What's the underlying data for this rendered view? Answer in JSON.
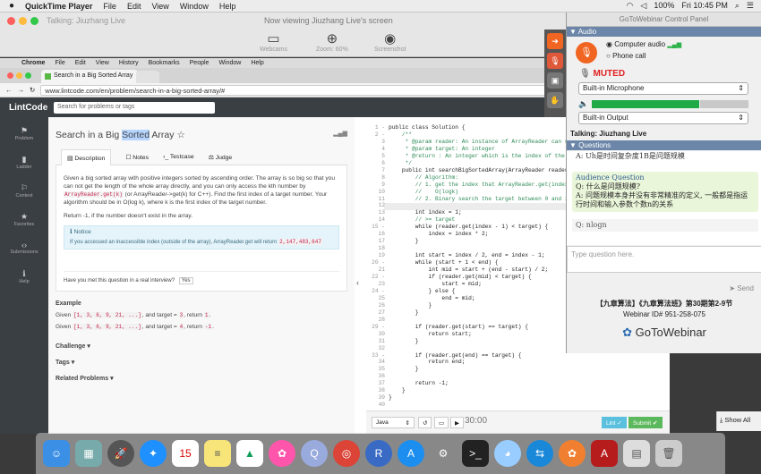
{
  "menubar": {
    "apple": "",
    "app": "QuickTime Player",
    "items": [
      "File",
      "Edit",
      "View",
      "Window",
      "Help"
    ],
    "battery": "100%",
    "clock": "Fri 10:45 PM"
  },
  "quicktime": {
    "talking": "Talking: Jiuzhang Live",
    "viewing": "Now viewing Jiuzhang Live's screen",
    "webcams": "Webcams",
    "zoom": "Zoom: 60%",
    "screenshot": "Screenshot"
  },
  "chrome": {
    "menu": [
      "Chrome",
      "File",
      "Edit",
      "View",
      "History",
      "Bookmarks",
      "People",
      "Window",
      "Help"
    ],
    "tab_title": "Search in a Big Sorted Array",
    "url": "www.lintcode.com/en/problem/search-in-a-big-sorted-array/#"
  },
  "lintcode": {
    "logo": "LintCode",
    "search_placeholder": "Search for problems or tags",
    "sidebar": [
      "Problem",
      "Ladder",
      "Contest",
      "Favorites",
      "Submissions",
      "Help"
    ],
    "title_pre": "Search in a Big ",
    "title_hl": "Sorted",
    "title_post": " Array",
    "star": "☆",
    "tabs": [
      "Description",
      "Notes",
      "Testcase",
      "Judge"
    ],
    "desc1": "Given a big sorted array with positive integers sorted by ascending order. The array is so big so that you can not get the length of the whole array directly, and you can only access the kth number by ",
    "code1": "ArrayReader.get(k)",
    "desc2": " (or ArrayReader->get(k) for C++). Find the first index of a target number. Your algorithm should be in O(log k), where k is the first index of the target number.",
    "desc3": "Return -1, if the number doesn't exist in the array.",
    "notice_title": "Notice",
    "notice_text": "If you accessed an inaccessible index (outside of the array), ArrayReader.get will return ",
    "notice_code": "2,147,483,647",
    "interview_q": "Have you met this question in a real interview?",
    "interview_yes": "Yes",
    "example": "Example",
    "ex1a": "Given ",
    "ex1b": "[1, 3, 6, 9, 21, ...]",
    "ex1c": ", and target = ",
    "ex1d": "3",
    "ex1e": ", return ",
    "ex1f": "1",
    "ex1g": ".",
    "ex2a": "Given ",
    "ex2b": "[1, 3, 6, 9, 21, ...]",
    "ex2c": ", and target = ",
    "ex2d": "4",
    "ex2e": ", return ",
    "ex2f": "-1",
    "ex2g": ".",
    "challenge": "Challenge",
    "tags": "Tags",
    "related": "Related Problems",
    "lang": "Java",
    "timer": "30:00",
    "lint_btn": "Lint",
    "submit_btn": "Submit"
  },
  "code_lines": [
    "public class Solution {",
    "    /**",
    "     * @param reader: An instance of ArrayReader can r",
    "     * @param target: An integer",
    "     * @return : An integer which is the index of the",
    "     */",
    "    public int searchBigSortedArray(ArrayReader reader",
    "        // Algorithm:",
    "        // 1. get the index that ArrayReader.get(index",
    "        //    O(logk)",
    "        // 2. Binary search the target between 0 and i",
    "",
    "        int index = 1;",
    "        // >= target",
    "        while (reader.get(index - 1) < target) {",
    "            index = index * 2;",
    "        }",
    "",
    "        int start = index / 2, end = index - 1;",
    "        while (start + 1 < end) {",
    "            int mid = start + (end - start) / 2;",
    "            if (reader.get(mid) < target) {",
    "                start = mid;",
    "            } else {",
    "                end = mid;",
    "            }",
    "        }",
    "",
    "        if (reader.get(start) == target) {",
    "            return start;",
    "        }",
    "",
    "        if (reader.get(end) == target) {",
    "            return end;",
    "        }",
    "",
    "        return -1;",
    "    }",
    "}",
    ""
  ],
  "gtw": {
    "title": "GoToWebinar Control Panel",
    "audio": "Audio",
    "computer_audio": "Computer audio",
    "phone_call": "Phone call",
    "muted": "MUTED",
    "mic": "Built-in Microphone",
    "output": "Built-in Output",
    "talking": "Talking:  Jiuzhang Live",
    "questions": "Questions",
    "q_prev": "A: Uh是时间复杂度1B是问题规模",
    "aq_title": "Audience Question",
    "aq_q": "Q: 什么是问题规模?",
    "aq_a": "A: 问题规模本身并没有非常精准的定义, 一般都是指运行时间和输入参数个数n的关系",
    "q_next": "Q: nlogn",
    "type_q": "Type question here.",
    "send": "Send",
    "course": "【九章算法】《九章算法班》第30期第2-9节",
    "webinar_id": "Webinar ID# 951-258-075",
    "brand": "GoToWebinar"
  },
  "show_all": "Show All",
  "colors": {
    "accent_orange": "#f16522",
    "gtw_blue": "#6b86a8",
    "lintcode_dark": "#3a3f44",
    "submit_green": "#5cb85c"
  }
}
